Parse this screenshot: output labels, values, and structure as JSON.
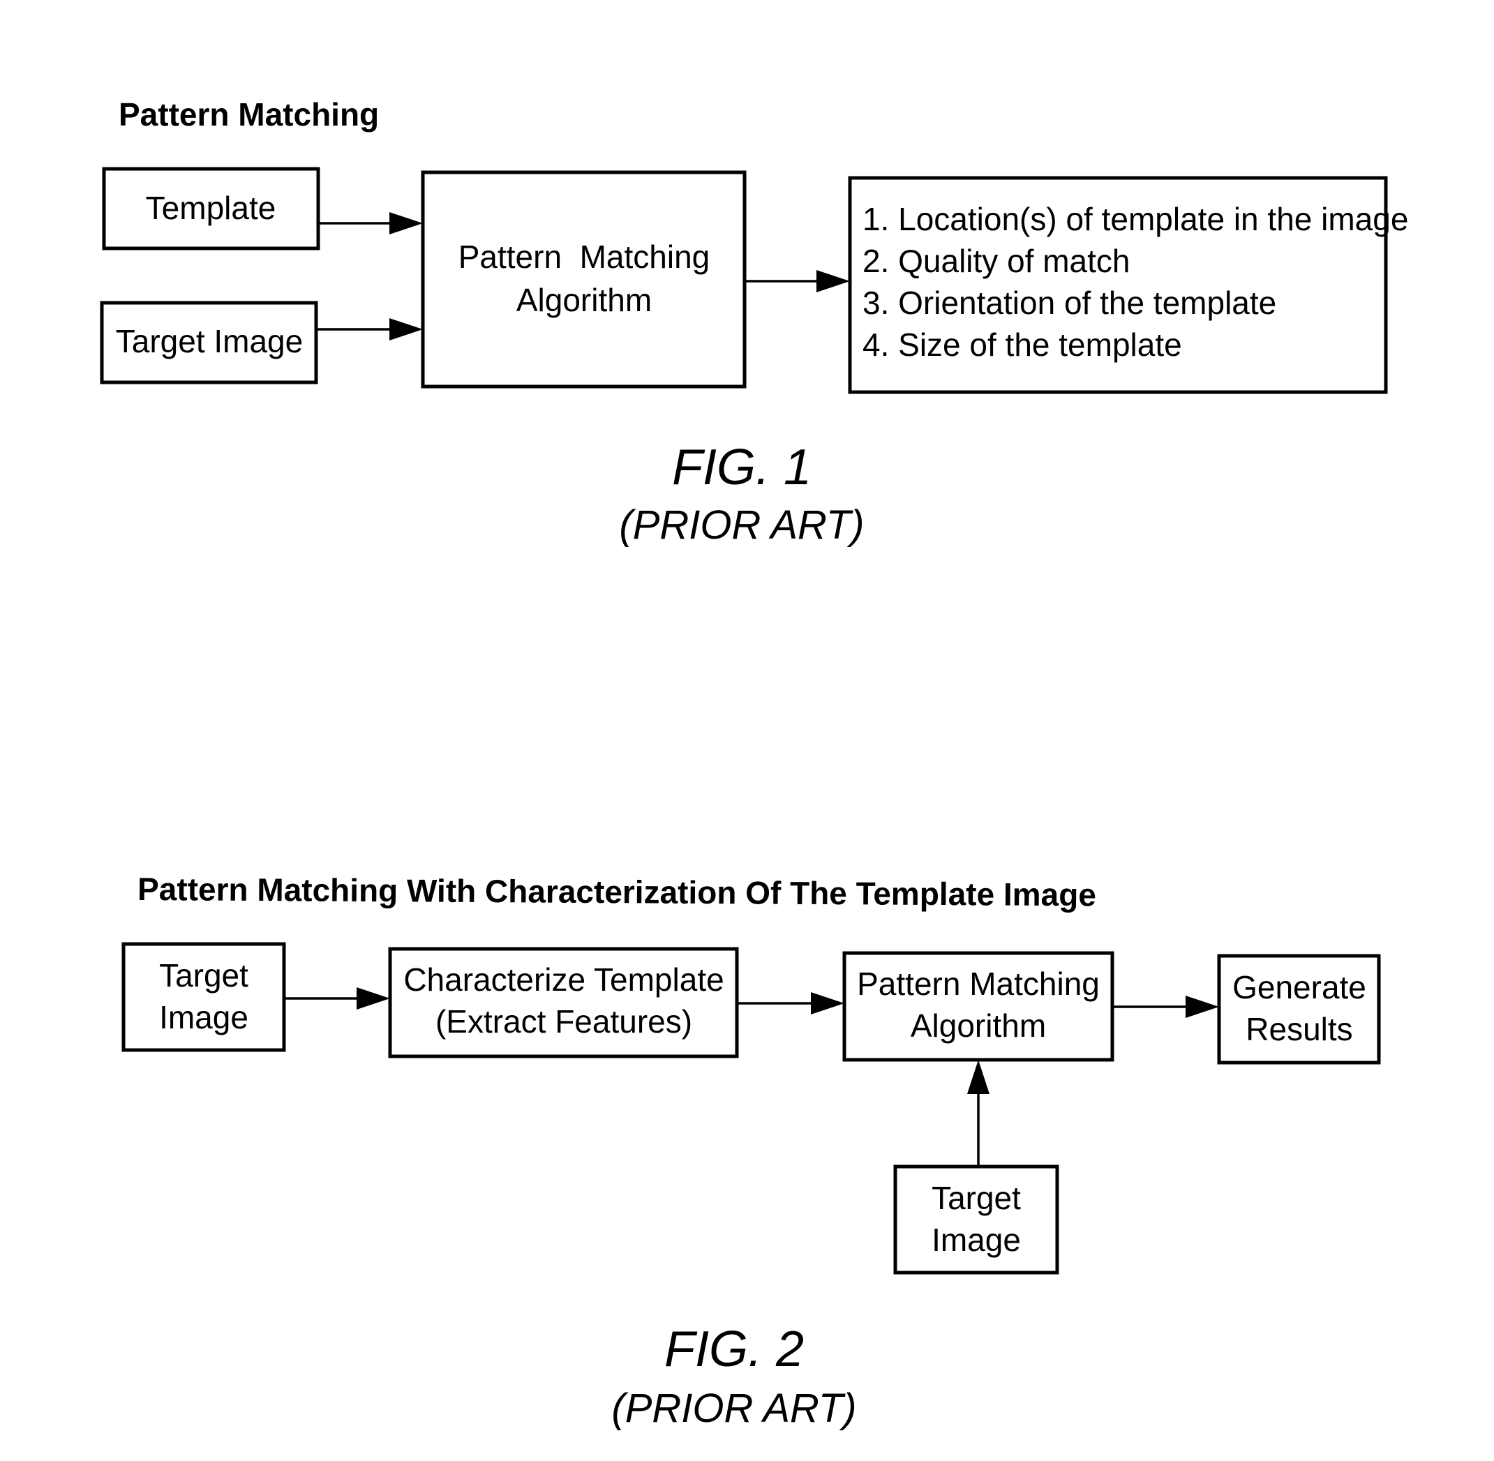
{
  "figure1": {
    "title": "Pattern Matching",
    "nodes": {
      "template": {
        "lines": [
          "Template"
        ]
      },
      "target_image": {
        "lines": [
          "Target Image"
        ]
      },
      "algorithm": {
        "lines": [
          "Pattern  Matching",
          "Algorithm"
        ]
      },
      "results": {
        "lines": [
          "1. Location(s) of template in the image",
          "2. Quality of match",
          "3. Orientation of the template",
          "4. Size of the template"
        ]
      }
    },
    "edges": [
      {
        "from": "template",
        "to": "algorithm"
      },
      {
        "from": "target_image",
        "to": "algorithm"
      },
      {
        "from": "algorithm",
        "to": "results"
      }
    ],
    "caption": "FIG. 1",
    "subcaption": "(PRIOR ART)"
  },
  "figure2": {
    "title": "Pattern Matching With Characterization Of The Template Image",
    "nodes": {
      "target_image_1": {
        "lines": [
          "Target",
          "Image"
        ]
      },
      "characterize": {
        "lines": [
          "Characterize Template",
          "(Extract Features)"
        ]
      },
      "algorithm": {
        "lines": [
          "Pattern Matching",
          "Algorithm"
        ]
      },
      "generate": {
        "lines": [
          "Generate",
          "Results"
        ]
      },
      "target_image_2": {
        "lines": [
          "Target",
          "Image"
        ]
      }
    },
    "edges": [
      {
        "from": "target_image_1",
        "to": "characterize"
      },
      {
        "from": "characterize",
        "to": "algorithm"
      },
      {
        "from": "algorithm",
        "to": "generate"
      },
      {
        "from": "target_image_2",
        "to": "algorithm"
      }
    ],
    "caption": "FIG. 2",
    "subcaption": "(PRIOR ART)"
  }
}
